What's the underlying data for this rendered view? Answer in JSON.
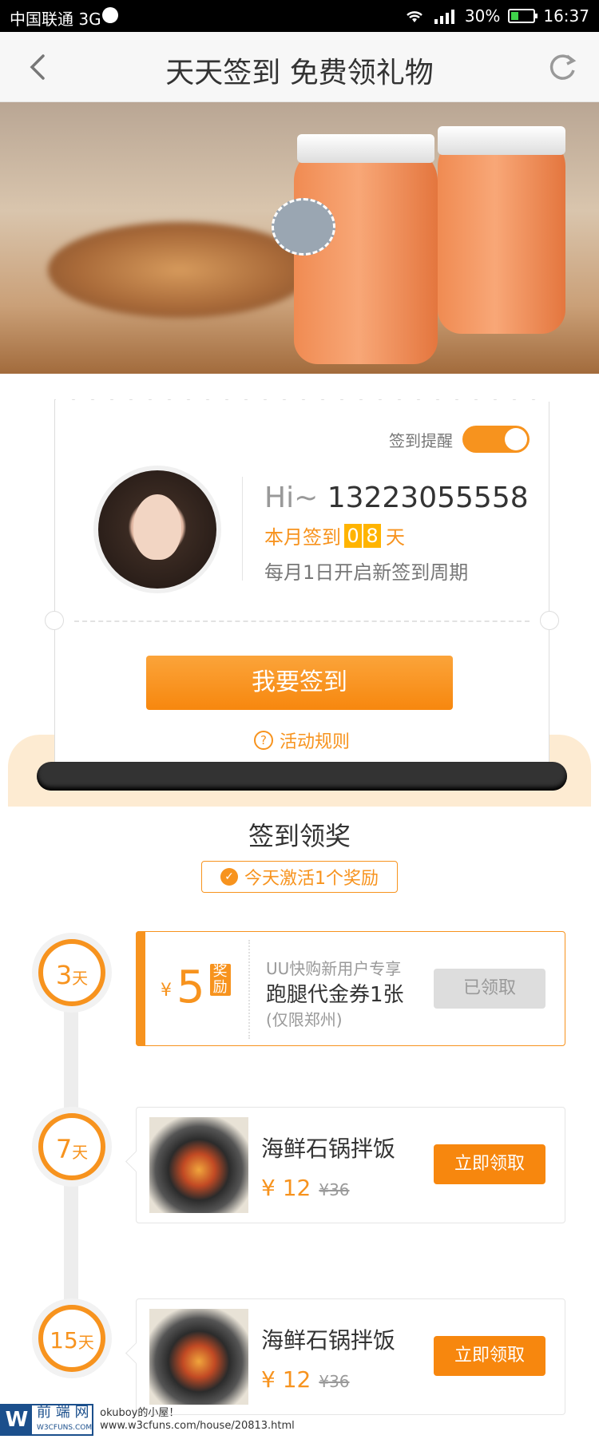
{
  "status_bar": {
    "carrier": "中国联通 3G",
    "battery": "30%",
    "time": "16:37"
  },
  "nav": {
    "title": "天天签到 免费领礼物"
  },
  "sign_card": {
    "remind_label": "签到提醒",
    "remind_on": true,
    "greeting_prefix": "Hi~ ",
    "phone": "13223055558",
    "month_prefix": "本月签到",
    "month_digits": [
      "0",
      "8"
    ],
    "month_suffix": "天",
    "cycle_text": "每月1日开启新签到周期",
    "sign_button": "我要签到",
    "rules_link": "活动规则"
  },
  "rewards": {
    "title": "签到领奖",
    "badge": "今天激活1个奖励",
    "coupon": {
      "day": "3",
      "day_unit": "天",
      "currency": "¥",
      "amount": "5",
      "tag": "奖励",
      "subtitle": "UU快购新用户专享",
      "name": "跑腿代金券1张",
      "note": "(仅限郑州)",
      "status": "已领取"
    },
    "items": [
      {
        "day": "7",
        "day_unit": "天",
        "name": "海鲜石锅拌饭",
        "price": "¥ 12",
        "old_price": "¥36",
        "button": "立即领取"
      },
      {
        "day": "15",
        "day_unit": "天",
        "name": "海鲜石锅拌饭",
        "price": "¥ 12",
        "old_price": "¥36",
        "button": "立即领取"
      }
    ]
  },
  "watermark": {
    "logo_letter": "W",
    "logo_text": "前 端 网",
    "logo_sub": "W3CFUNS.COM",
    "line1": "okuboy的小屋！",
    "line2": "www.w3cfuns.com/house/20813.html"
  },
  "colors": {
    "accent": "#f7931e",
    "button": "#f7870e",
    "highlight": "#ffb400"
  }
}
